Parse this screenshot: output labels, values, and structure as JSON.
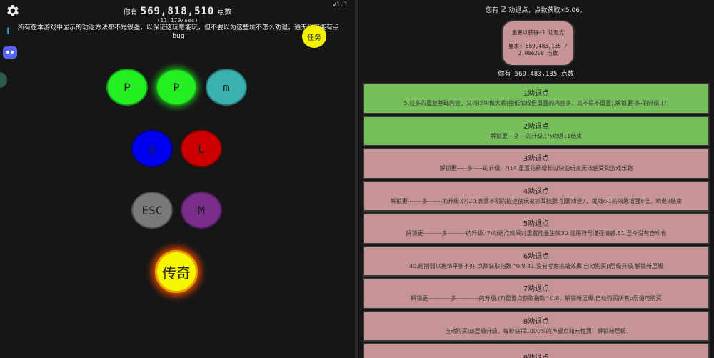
{
  "left": {
    "version": "v1.1",
    "points_prefix": "你有",
    "points_value": "569,818,510",
    "points_suffix": "点数",
    "rate": "(11,179/sec)",
    "notice": "所有在本游戏中显示的劝退方法都不是很强，以保证这玩意能玩，但不要以为这些坑不怎么劝退，通天也可能有点bug",
    "task_label": "任务",
    "layers": [
      {
        "label": "P",
        "color": "#22ee22"
      },
      {
        "label": "P",
        "color": "#22ee22"
      },
      {
        "label": "m",
        "color": "#3ab0b0"
      },
      {
        "label": "q",
        "color": "#0000ee"
      },
      {
        "label": "L",
        "color": "#cc0000"
      },
      {
        "label": "ESC",
        "color": "#7a7a7a"
      },
      {
        "label": "M",
        "color": "#7a2c8a"
      }
    ],
    "legend_label": "传奇",
    "icons": [
      "gear-icon",
      "info-icon",
      "discord-icon"
    ]
  },
  "right": {
    "head_prefix": "您有",
    "head_value": "2",
    "head_suffix": "劝退点，点数获取×5.06。",
    "reset_title": "重置以获得+1 劝退点",
    "reset_req": "要求: 569,483,135 / 2.00e200 点数",
    "points_line": "你有 569,483,135 点数",
    "milestones": [
      {
        "title": "1劝退点",
        "desc": "5.过多的重复基础内容，又可以叫做大转(指低加成但重置的内容多，又不得不重置).解锁更-多-的升级.(?)",
        "state": "done"
      },
      {
        "title": "2劝退点",
        "desc": "解锁更---多---的升级.(?)劝退11结束",
        "state": "done"
      },
      {
        "title": "3劝退点",
        "desc": "解锁更-----多-----的升级.(?)14.重置花费增长过快使玩家无法感受到游戏乐趣",
        "state": "locked"
      },
      {
        "title": "4劝退点",
        "desc": "解锁更-------多-------的升级.(?)20.表意不明的描述使玩家抓耳挠腮.削弱劝退7，挑战c-1的效果增强8倍，劝退9结束",
        "state": "locked"
      },
      {
        "title": "5劝退点",
        "desc": "解锁更---------多---------的升级.(?)劝退点效果对重置能量生效30.滥用符号增强情感.31.至今没有自动化",
        "state": "locked"
      },
      {
        "title": "6劝退点",
        "desc": "40.给削弱以掩饰平衡不好.点数获取指数^0.8.41.没有考虑挑战效果.自动购买p层级升级.解锁新层级",
        "state": "locked"
      },
      {
        "title": "7劝退点",
        "desc": "解锁更-----------多-----------的升级.(?)重置点获取指数^0.8，解锁新层级.自动购买所有p层级可购买",
        "state": "locked"
      },
      {
        "title": "8劝退点",
        "desc": "自动购买pp层级升级，每秒获得1000%的声望点和元性质，解锁新层级.",
        "state": "locked"
      },
      {
        "title": "9劝退点",
        "desc": "",
        "state": "locked"
      }
    ]
  }
}
